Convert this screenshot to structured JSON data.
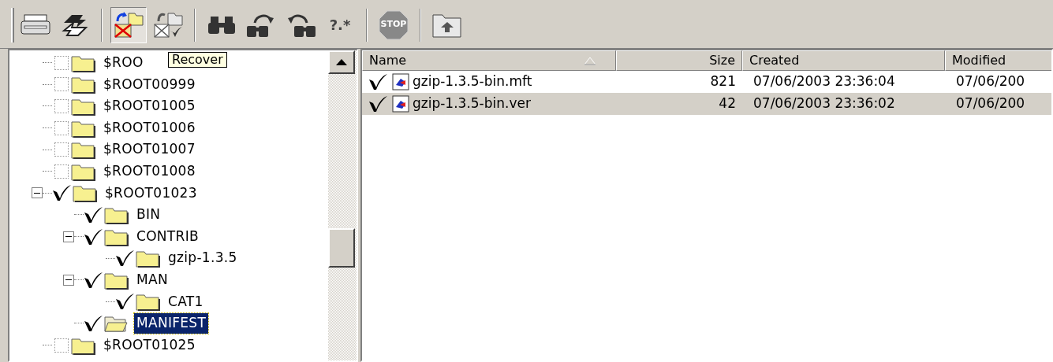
{
  "toolbar": [
    {
      "kind": "printer",
      "selected": false
    },
    {
      "kind": "sync",
      "selected": false
    },
    {
      "kind": "recover",
      "selected": true
    },
    {
      "kind": "recover-checked",
      "selected": false
    },
    {
      "kind": "find",
      "selected": false
    },
    {
      "kind": "find-next",
      "selected": false
    },
    {
      "kind": "find-prev",
      "selected": false
    },
    {
      "kind": "mask",
      "label": "?.*",
      "selected": false
    },
    {
      "kind": "stop",
      "label": "STOP",
      "selected": false
    },
    {
      "kind": "up",
      "selected": false
    }
  ],
  "tooltip": "Recover",
  "tree": [
    {
      "label": "$ROO",
      "checked": false,
      "selected": false
    },
    {
      "label": "$ROOT00999",
      "checked": false,
      "selected": false
    },
    {
      "label": "$ROOT01005",
      "checked": false,
      "selected": false
    },
    {
      "label": "$ROOT01006",
      "checked": false,
      "selected": false
    },
    {
      "label": "$ROOT01007",
      "checked": false,
      "selected": false
    },
    {
      "label": "$ROOT01008",
      "checked": false,
      "selected": false
    },
    {
      "label": "$ROOT01023",
      "checked": true,
      "selected": false,
      "expanded": true,
      "children": [
        {
          "label": "BIN",
          "checked": true,
          "selected": false
        },
        {
          "label": "CONTRIB",
          "checked": true,
          "selected": false,
          "expanded": true,
          "children": [
            {
              "label": "gzip-1.3.5",
              "checked": true,
              "selected": false
            }
          ]
        },
        {
          "label": "MAN",
          "checked": true,
          "selected": false,
          "expanded": true,
          "children": [
            {
              "label": "CAT1",
              "checked": true,
              "selected": false
            }
          ]
        },
        {
          "label": "MANIFEST",
          "checked": true,
          "selected": true
        }
      ]
    },
    {
      "label": "$ROOT01025",
      "checked": false,
      "selected": false
    }
  ],
  "table": {
    "columns": [
      "Name",
      "Size",
      "Created",
      "Modified"
    ],
    "rows": [
      {
        "checked": true,
        "selected": false,
        "name": "gzip-1.3.5-bin.mft",
        "size": "821",
        "created": "07/06/2003 23:36:04",
        "modified": "07/06/200"
      },
      {
        "checked": true,
        "selected": true,
        "name": "gzip-1.3.5-bin.ver",
        "size": "42",
        "created": "07/06/2003 23:36:02",
        "modified": "07/06/200"
      }
    ]
  }
}
